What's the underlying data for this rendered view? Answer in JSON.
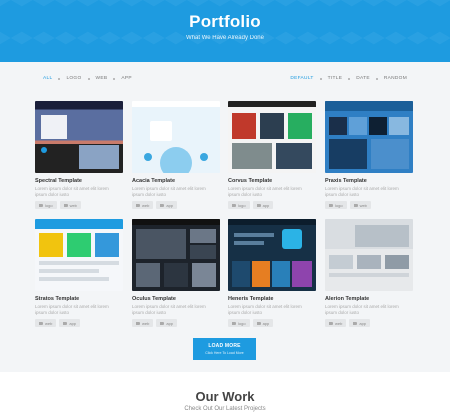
{
  "hero": {
    "title": "Portfolio",
    "subtitle": "What We Have Already Done",
    "color": "#1e9be0"
  },
  "filters": {
    "left": [
      "ALL",
      "LOGO",
      "WEB",
      "APP"
    ],
    "right": [
      "DEFAULT",
      "TITLE",
      "DATE",
      "RANDOM"
    ],
    "active_left": "ALL",
    "active_right": "DEFAULT"
  },
  "portfolio": [
    {
      "title": "Spectral Template",
      "desc": "Lorem ipsum dolor sit amet elit lorem ipsum dolor iusto",
      "tags": [
        "logo",
        "web"
      ]
    },
    {
      "title": "Acacia Template",
      "desc": "Lorem ipsum dolor sit amet elit lorem ipsum dolor iusto",
      "tags": [
        "web",
        "app"
      ]
    },
    {
      "title": "Corvus Template",
      "desc": "Lorem ipsum dolor sit amet elit lorem ipsum dolor iusto",
      "tags": [
        "logo",
        "app"
      ]
    },
    {
      "title": "Praxis Template",
      "desc": "Lorem ipsum dolor sit amet elit lorem ipsum dolor iusto",
      "tags": [
        "logo",
        "web"
      ]
    },
    {
      "title": "Stratos Template",
      "desc": "Lorem ipsum dolor sit amet elit lorem ipsum dolor iusto",
      "tags": [
        "web",
        "app"
      ]
    },
    {
      "title": "Oculus Template",
      "desc": "Lorem ipsum dolor sit amet elit lorem ipsum dolor iusto",
      "tags": [
        "web",
        "app"
      ]
    },
    {
      "title": "Heneris Template",
      "desc": "Lorem ipsum dolor sit amet elit lorem ipsum dolor iusto",
      "tags": [
        "logo",
        "app"
      ]
    },
    {
      "title": "Alerion Template",
      "desc": "Lorem ipsum dolor sit amet elit lorem ipsum dolor iusto",
      "tags": [
        "web",
        "app"
      ]
    }
  ],
  "load_more": {
    "label": "LOAD MORE",
    "sublabel": "Click Here To Load More"
  },
  "our_work": {
    "title": "Our Work",
    "subtitle": "Check Out Our Latest Projects"
  }
}
